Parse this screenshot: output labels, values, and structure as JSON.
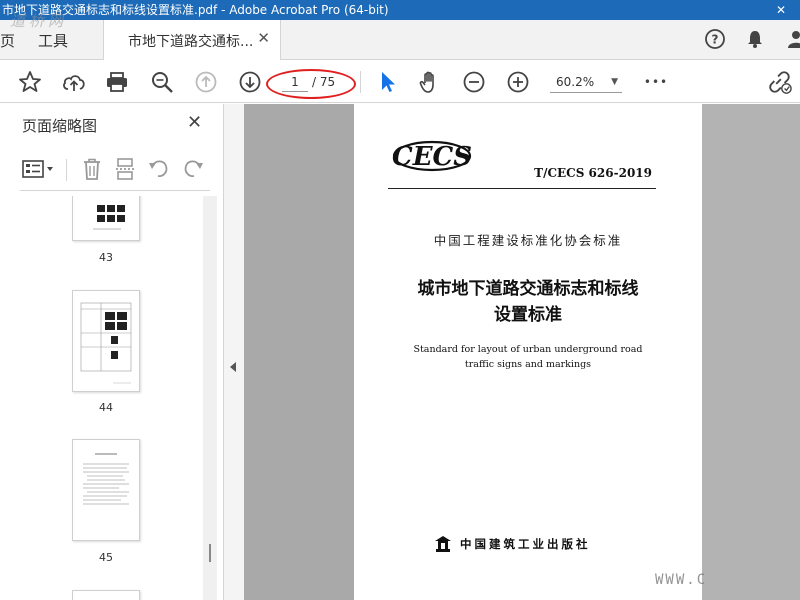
{
  "window": {
    "title": "市地下道路交通标志和标线设置标准.pdf - Adobe Acrobat Pro (64-bit)",
    "close_glyph": "✕",
    "watermark": "道桥网"
  },
  "menu": {
    "items": [
      "页",
      "工具"
    ]
  },
  "tab": {
    "label": "市地下道路交通标...",
    "close_glyph": "✕"
  },
  "toolbar": {
    "page_current": "1",
    "page_total": "/ 75",
    "zoom": "60.2%",
    "more_glyph": "•••",
    "icons": [
      "star-icon",
      "upload-icon",
      "print-icon",
      "zoom-search-icon",
      "arrow-up-icon",
      "arrow-down-icon",
      "cursor-icon",
      "hand-icon",
      "zoom-out-icon",
      "zoom-in-icon",
      "more-icon",
      "link-icon"
    ]
  },
  "panel": {
    "title": "页面缩略图",
    "close_glyph": "✕",
    "thumbnails": [
      {
        "label": "43"
      },
      {
        "label": "44"
      },
      {
        "label": "45"
      }
    ]
  },
  "document": {
    "logo_text": "CECS",
    "std_code": "T/CECS 626-2019",
    "association": "中国工程建设标准化协会标准",
    "title_line1": "城市地下道路交通标志和标线",
    "title_line2": "设置标准",
    "english_line1": "Standard for layout of urban underground road",
    "english_line2": "traffic signs and markings",
    "publisher": "中国建筑工业出版社"
  },
  "corner_watermark": "WWW.C",
  "colors": {
    "titlebar": "#1c6ab8",
    "accent_blue": "#1473e6",
    "annotation_red": "#e02020"
  }
}
